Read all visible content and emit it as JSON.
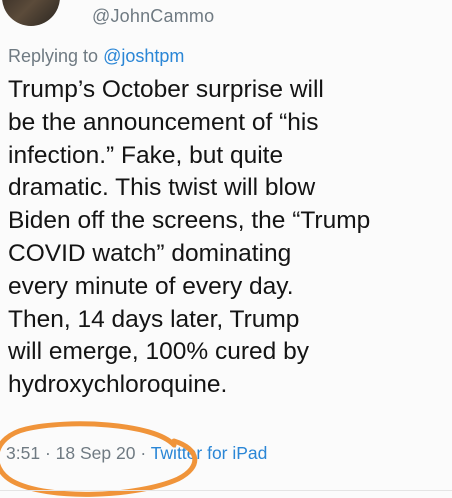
{
  "header": {
    "handle": "@JohnCammo"
  },
  "reply": {
    "prefix": "Replying to",
    "mention": "@joshtpm"
  },
  "tweet": {
    "lines": [
      "Trump’s October surprise will",
      "be the announcement of “his",
      "infection.”  Fake, but quite",
      "dramatic. This twist will blow",
      "Biden off the screens, the “Trump",
      "COVID watch” dominating",
      "every minute of every day.",
      "Then, 14 days later, Trump",
      "will emerge, 100% cured by",
      "hydroxychloroquine."
    ]
  },
  "meta": {
    "time": "3:51",
    "date": "18 Sep 20",
    "separator": "·",
    "source": "Twitter for iPad"
  },
  "colors": {
    "text": "#141414",
    "muted": "#6f7a82",
    "link": "#2a86d6",
    "annotation": "#f0943a"
  }
}
